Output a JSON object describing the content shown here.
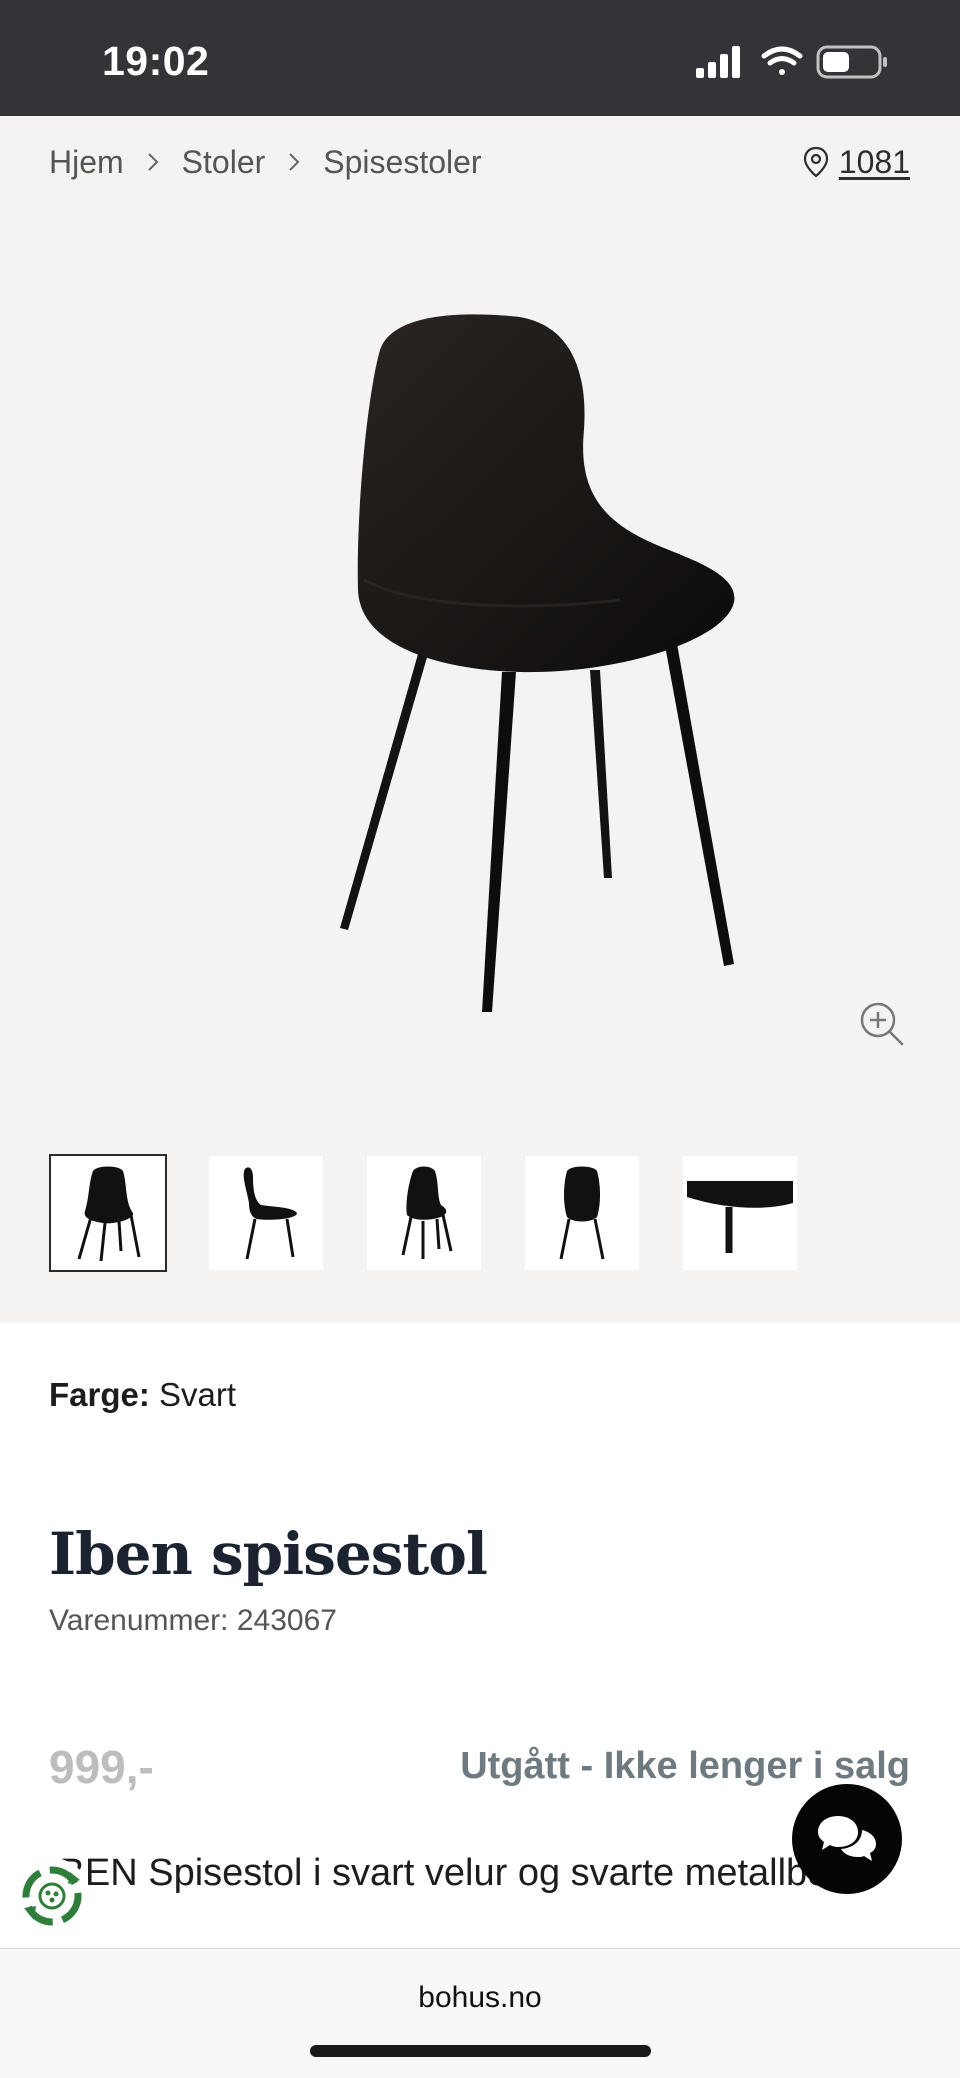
{
  "status_bar": {
    "time": "19:02",
    "icons": [
      "signal-icon",
      "wifi-icon",
      "battery-icon"
    ]
  },
  "breadcrumb": {
    "items": [
      "Hjem",
      "Stoler",
      "Spisestoler"
    ]
  },
  "store": {
    "code": "1081",
    "icon": "location-pin-icon"
  },
  "gallery": {
    "thumbnail_count": 5,
    "active_index": 0
  },
  "product": {
    "color_label": "Farge:",
    "color_value": "Svart",
    "title": "Iben spisestol",
    "sku": "Varenummer: 243067",
    "price": "999,-",
    "availability": "Utgått - Ikke lenger i salg",
    "description": "IBEN Spisestol i svart velur og svarte metallben"
  },
  "browser": {
    "url": "bohus.no"
  },
  "colors": {
    "status_bar_bg": "#343338",
    "gallery_bg": "#f5f3f2",
    "availability": "#6e7a7f",
    "price": "#bdbdbd"
  }
}
